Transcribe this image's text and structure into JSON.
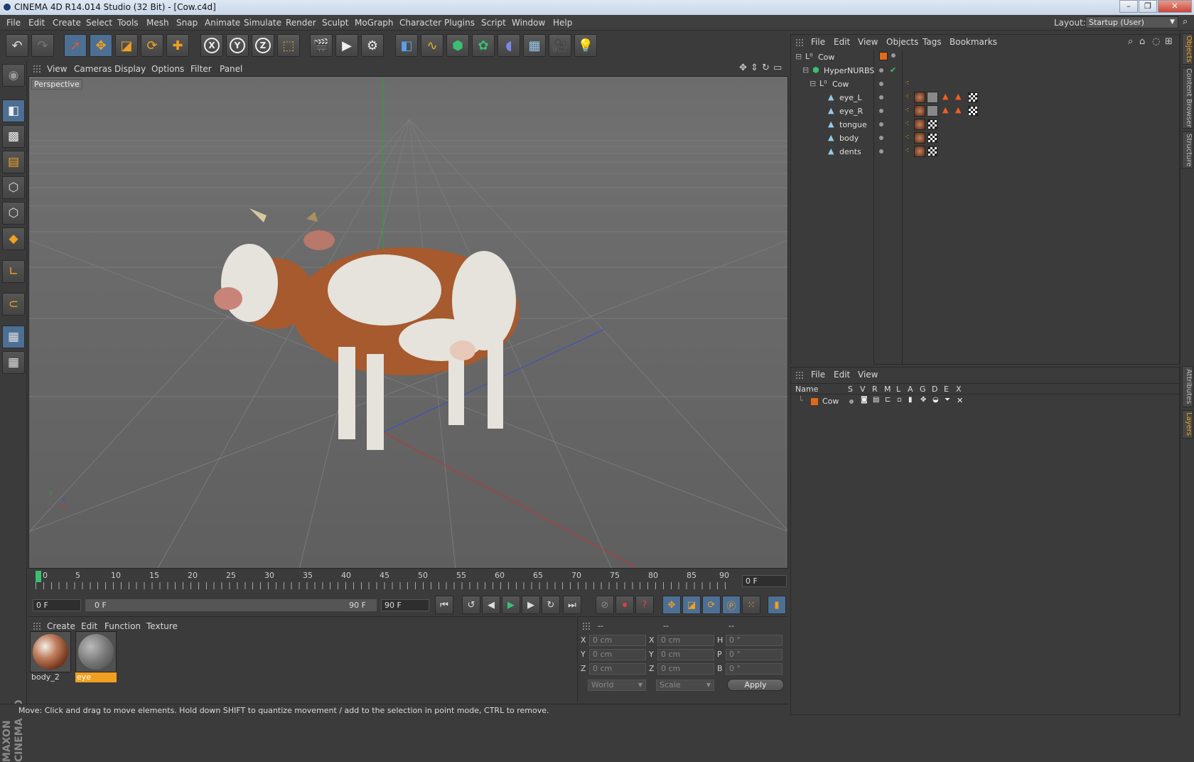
{
  "window": {
    "title": "CINEMA 4D R14.014 Studio (32 Bit) - [Cow.c4d]",
    "minimize": "–",
    "maximize": "❐",
    "close": "✕"
  },
  "menubar": {
    "items": [
      "File",
      "Edit",
      "Create",
      "Select",
      "Tools",
      "Mesh",
      "Snap",
      "Animate",
      "Simulate",
      "Render",
      "Sculpt",
      "MoGraph",
      "Character",
      "Plugins",
      "Script",
      "Window",
      "Help"
    ],
    "layout_label": "Layout:",
    "layout_value": "Startup (User)"
  },
  "toolbar": {
    "axes": [
      "X",
      "Y",
      "Z"
    ]
  },
  "viewport": {
    "menu": [
      "View",
      "Cameras",
      "Display",
      "Options",
      "Filter",
      "Panel"
    ],
    "label": "Perspective",
    "axis_y": "y",
    "axis_z": "z",
    "axis_x": "x"
  },
  "timeline": {
    "ticks": [
      "0",
      "5",
      "10",
      "15",
      "20",
      "25",
      "30",
      "35",
      "40",
      "45",
      "50",
      "55",
      "60",
      "65",
      "70",
      "75",
      "80",
      "85",
      "90"
    ],
    "current_frame": "0 F"
  },
  "transport": {
    "start_frame": "0 F",
    "range_start": "0 F",
    "range_end": "90 F",
    "end_frame": "90 F"
  },
  "materials": {
    "menu": [
      "Create",
      "Edit",
      "Function",
      "Texture"
    ],
    "items": [
      {
        "name": "body_2",
        "selected": false
      },
      {
        "name": "eye",
        "selected": true
      }
    ]
  },
  "coordinates": {
    "headers": [
      "--",
      "--",
      "--"
    ],
    "rows": [
      {
        "axis": "X",
        "pos": "0 cm",
        "axis2": "X",
        "size": "0 cm",
        "rot_axis": "H",
        "rot": "0 °"
      },
      {
        "axis": "Y",
        "pos": "0 cm",
        "axis2": "Y",
        "size": "0 cm",
        "rot_axis": "P",
        "rot": "0 °"
      },
      {
        "axis": "Z",
        "pos": "0 cm",
        "axis2": "Z",
        "size": "0 cm",
        "rot_axis": "B",
        "rot": "0 °"
      }
    ],
    "mode": "World",
    "scale": "Scale",
    "apply": "Apply"
  },
  "status": "Move: Click and drag to move elements. Hold down SHIFT to quantize movement / add to the selection in point mode, CTRL to remove.",
  "object_manager": {
    "menu": [
      "File",
      "Edit",
      "View",
      "Objects",
      "Tags",
      "Bookmarks"
    ],
    "objects": [
      {
        "name": "Cow",
        "indent": 0
      },
      {
        "name": "HyperNURBS",
        "indent": 1
      },
      {
        "name": "Cow",
        "indent": 2
      },
      {
        "name": "eye_L",
        "indent": 3
      },
      {
        "name": "eye_R",
        "indent": 3
      },
      {
        "name": "tongue",
        "indent": 3
      },
      {
        "name": "body",
        "indent": 3
      },
      {
        "name": "dents",
        "indent": 3
      }
    ]
  },
  "layer_manager": {
    "menu": [
      "File",
      "Edit",
      "View"
    ],
    "headers": [
      "Name",
      "S",
      "V",
      "R",
      "M",
      "L",
      "A",
      "G",
      "D",
      "E",
      "X"
    ],
    "layers": [
      {
        "name": "Cow",
        "color": "#e06a1a"
      }
    ]
  },
  "right_tabs": [
    "Objects",
    "Content Browser",
    "Structure",
    "Attributes",
    "Layers"
  ],
  "colors": {
    "accent": "#f0a020",
    "axis_x": "#c83232",
    "axis_y": "#2ea02e",
    "axis_z": "#3a4fc8"
  }
}
